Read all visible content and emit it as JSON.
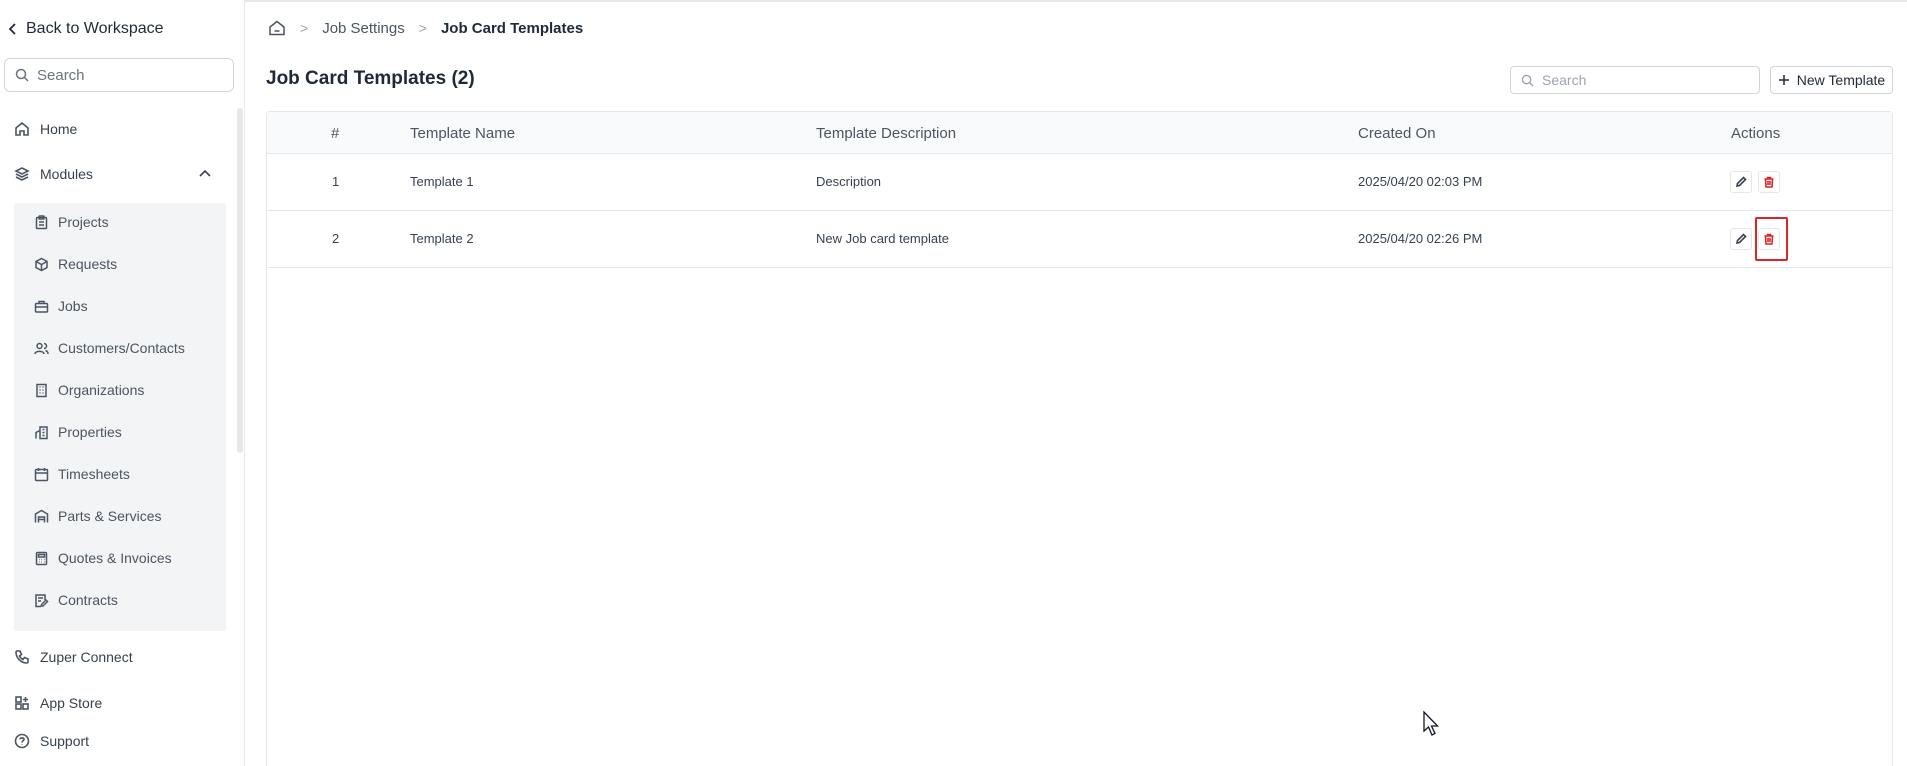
{
  "sidebar": {
    "back_label": "Back to Workspace",
    "search_placeholder": "Search",
    "home_label": "Home",
    "modules_label": "Modules",
    "modules": [
      {
        "label": "Projects",
        "icon": "clipboard-icon"
      },
      {
        "label": "Requests",
        "icon": "box-icon"
      },
      {
        "label": "Jobs",
        "icon": "briefcase-icon"
      },
      {
        "label": "Customers/Contacts",
        "icon": "users-icon"
      },
      {
        "label": "Organizations",
        "icon": "building-icon"
      },
      {
        "label": "Properties",
        "icon": "property-icon"
      },
      {
        "label": "Timesheets",
        "icon": "calendar-icon"
      },
      {
        "label": "Parts & Services",
        "icon": "warehouse-icon"
      },
      {
        "label": "Quotes & Invoices",
        "icon": "calculator-icon"
      },
      {
        "label": "Contracts",
        "icon": "contract-icon"
      }
    ],
    "bottom": [
      {
        "label": "Zuper Connect",
        "icon": "phone-icon"
      },
      {
        "label": "App Store",
        "icon": "apps-icon"
      },
      {
        "label": "Support",
        "icon": "help-icon"
      }
    ]
  },
  "breadcrumb": {
    "home_icon": "home-icon",
    "parent": "Job Settings",
    "current": "Job Card Templates"
  },
  "page": {
    "title": "Job Card Templates (2)",
    "search_placeholder": "Search",
    "new_button": "New Template"
  },
  "table": {
    "columns": [
      "#",
      "Template Name",
      "Template Description",
      "Created On",
      "Actions"
    ],
    "rows": [
      {
        "num": "1",
        "name": "Template 1",
        "description": "Description",
        "created": "2025/04/20 02:03 PM"
      },
      {
        "num": "2",
        "name": "Template 2",
        "description": "New Job card template",
        "created": "2025/04/20 02:26 PM"
      }
    ]
  },
  "colors": {
    "highlight": "#dc2626",
    "delete_icon": "#dc2626"
  }
}
